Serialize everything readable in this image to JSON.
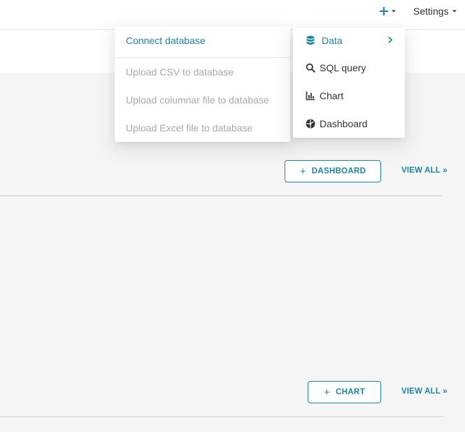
{
  "header": {
    "settings_label": "Settings"
  },
  "new_menu": {
    "items": [
      {
        "label": "Data",
        "icon": "database-icon"
      },
      {
        "label": "SQL query",
        "icon": "search-icon"
      },
      {
        "label": "Chart",
        "icon": "bar-chart-icon"
      },
      {
        "label": "Dashboard",
        "icon": "dashboard-icon"
      }
    ]
  },
  "data_submenu": {
    "items": [
      {
        "label": "Connect database",
        "enabled": true
      },
      {
        "label": "Upload CSV to database",
        "enabled": false
      },
      {
        "label": "Upload columnar file to database",
        "enabled": false
      },
      {
        "label": "Upload Excel file to database",
        "enabled": false
      }
    ]
  },
  "sections": {
    "dashboards": {
      "add_label": "DASHBOARD",
      "view_all_label": "VIEW ALL »"
    },
    "charts": {
      "add_label": "CHART",
      "view_all_label": "VIEW ALL »"
    }
  },
  "colors": {
    "accent": "#1a85a0",
    "disabled_text": "#a8a8a8",
    "background": "#f5f5f5"
  }
}
